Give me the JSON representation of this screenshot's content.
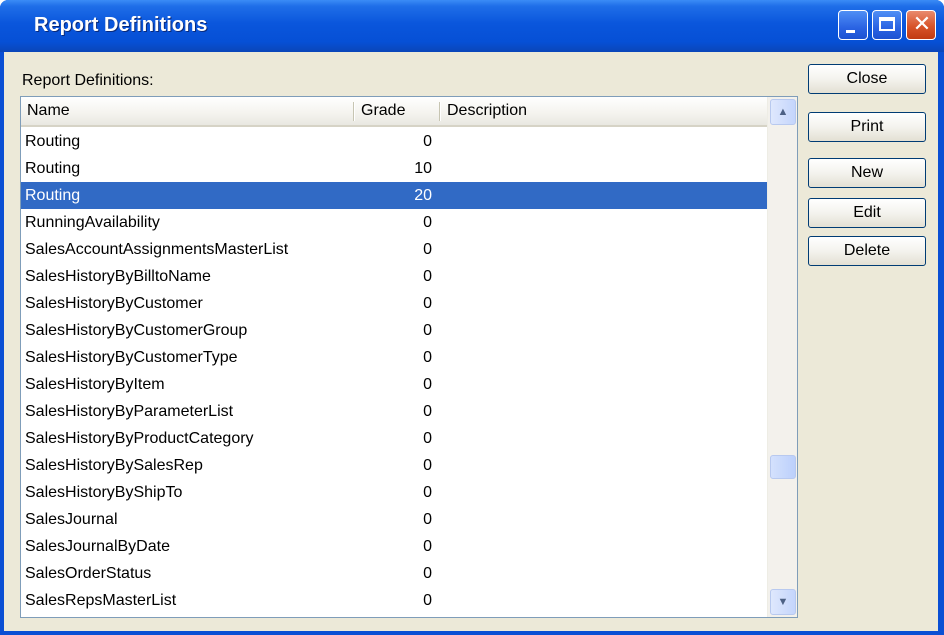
{
  "window": {
    "title": "Report Definitions",
    "minimize_label": "minimize",
    "maximize_label": "maximize",
    "close_label": "close"
  },
  "group_label": "Report Definitions:",
  "columns": {
    "name": "Name",
    "grade": "Grade",
    "description": "Description"
  },
  "rows": [
    {
      "name": "Routing",
      "grade": "0",
      "description": ""
    },
    {
      "name": "Routing",
      "grade": "10",
      "description": ""
    },
    {
      "name": "Routing",
      "grade": "20",
      "description": "",
      "selected": true
    },
    {
      "name": "RunningAvailability",
      "grade": "0",
      "description": ""
    },
    {
      "name": "SalesAccountAssignmentsMasterList",
      "grade": "0",
      "description": ""
    },
    {
      "name": "SalesHistoryByBilltoName",
      "grade": "0",
      "description": ""
    },
    {
      "name": "SalesHistoryByCustomer",
      "grade": "0",
      "description": ""
    },
    {
      "name": "SalesHistoryByCustomerGroup",
      "grade": "0",
      "description": ""
    },
    {
      "name": "SalesHistoryByCustomerType",
      "grade": "0",
      "description": ""
    },
    {
      "name": "SalesHistoryByItem",
      "grade": "0",
      "description": ""
    },
    {
      "name": "SalesHistoryByParameterList",
      "grade": "0",
      "description": ""
    },
    {
      "name": "SalesHistoryByProductCategory",
      "grade": "0",
      "description": ""
    },
    {
      "name": "SalesHistoryBySalesRep",
      "grade": "0",
      "description": ""
    },
    {
      "name": "SalesHistoryByShipTo",
      "grade": "0",
      "description": ""
    },
    {
      "name": "SalesJournal",
      "grade": "0",
      "description": ""
    },
    {
      "name": "SalesJournalByDate",
      "grade": "0",
      "description": ""
    },
    {
      "name": "SalesOrderStatus",
      "grade": "0",
      "description": ""
    },
    {
      "name": "SalesRepsMasterList",
      "grade": "0",
      "description": ""
    }
  ],
  "buttons": {
    "close": "Close",
    "print": "Print",
    "new": "New",
    "edit": "Edit",
    "delete": "Delete"
  },
  "scroll_icons": {
    "up": "scroll-up-arrow-icon",
    "down": "scroll-down-arrow-icon"
  },
  "colors": {
    "title_bar": "#0a56dc",
    "selection": "#316ac5",
    "dialog_face": "#ece9d8"
  }
}
